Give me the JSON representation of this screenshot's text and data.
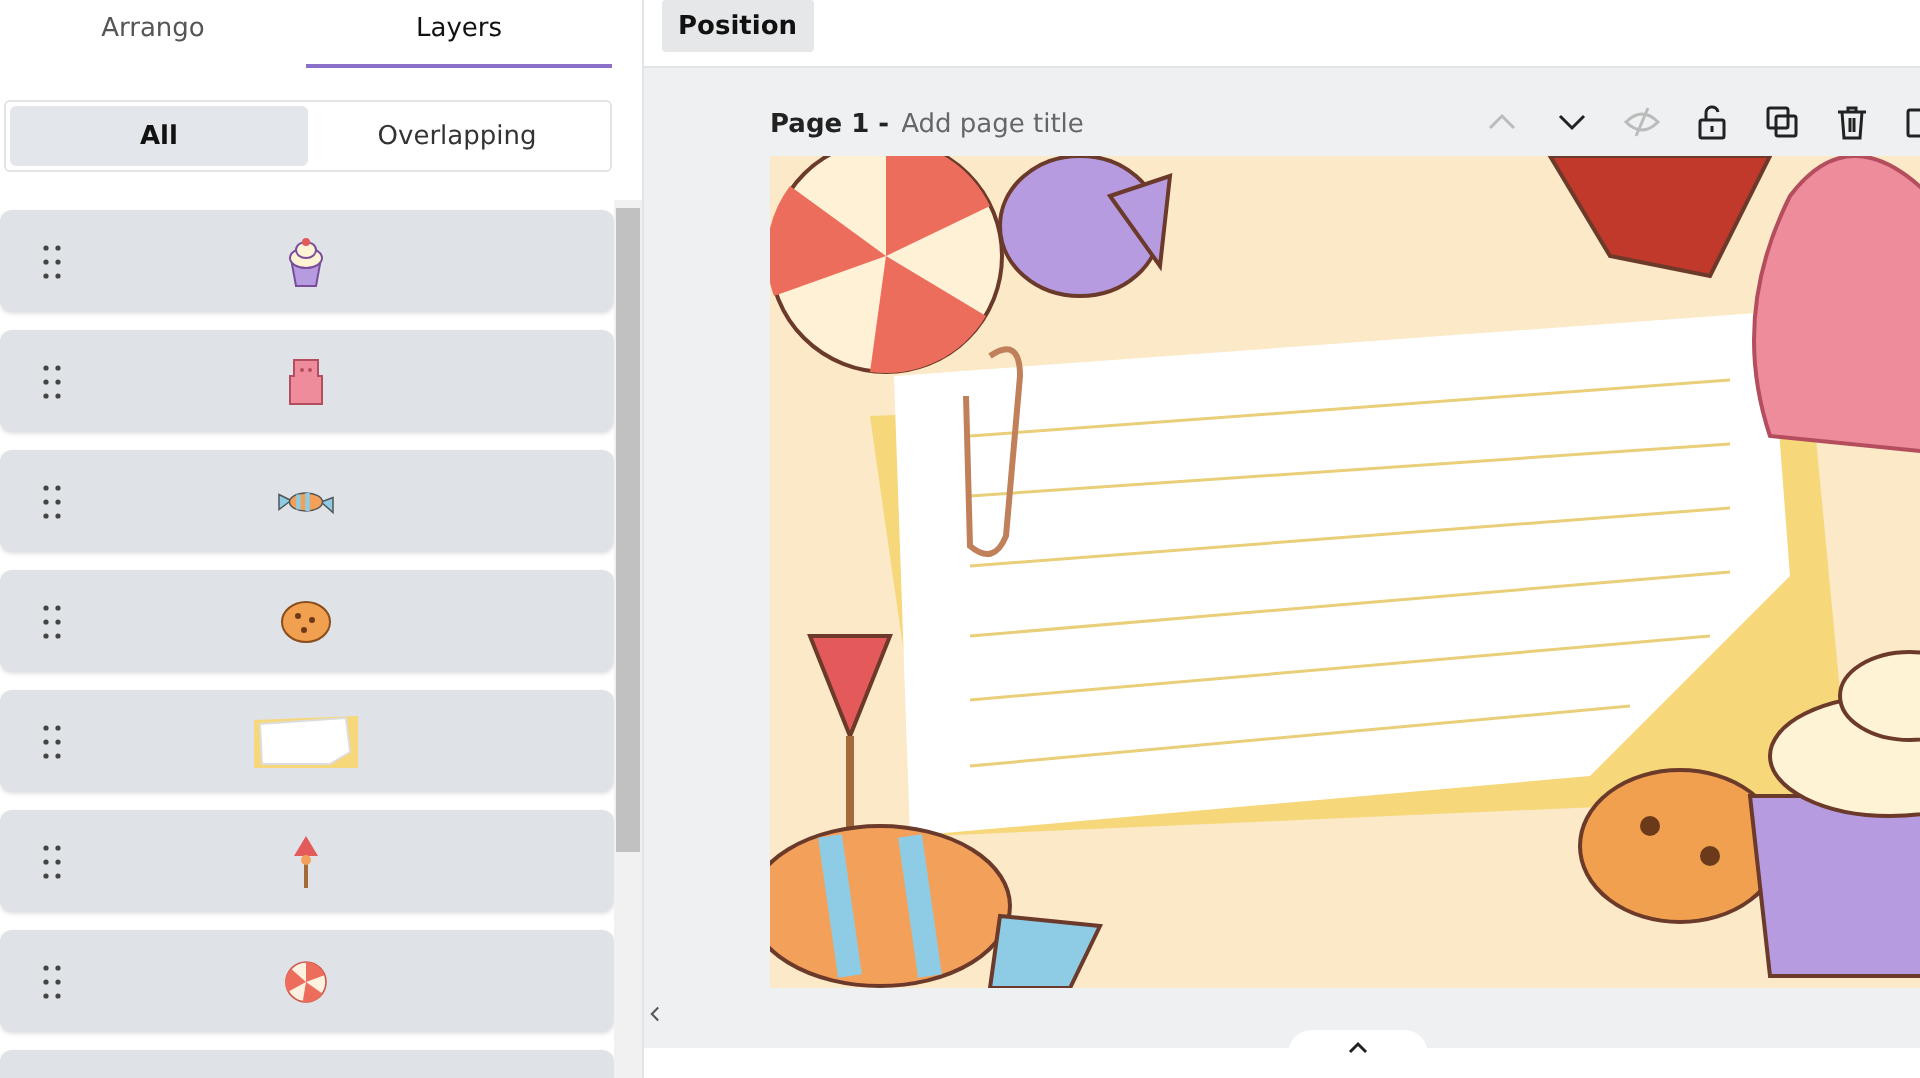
{
  "panel": {
    "tabs": [
      {
        "label": "Arrango",
        "selected": false
      },
      {
        "label": "Layers",
        "selected": true
      }
    ],
    "filters": [
      {
        "label": "All",
        "selected": true
      },
      {
        "label": "Overlapping",
        "selected": false
      }
    ],
    "layers": [
      {
        "kind": "cupcake"
      },
      {
        "kind": "gummy-bear"
      },
      {
        "kind": "wrapped-candy"
      },
      {
        "kind": "cookie"
      },
      {
        "kind": "note"
      },
      {
        "kind": "lollipop"
      },
      {
        "kind": "peppermint"
      },
      {
        "kind": "blank"
      }
    ]
  },
  "editor": {
    "position_button": "Position",
    "page": {
      "label": "Page 1 -",
      "title_placeholder": "Add page title"
    },
    "page_tools": [
      {
        "kind": "move-up",
        "disabled": true
      },
      {
        "kind": "move-down",
        "disabled": false
      },
      {
        "kind": "hide",
        "disabled": true
      },
      {
        "kind": "lock",
        "disabled": false
      },
      {
        "kind": "duplicate",
        "disabled": false
      },
      {
        "kind": "delete",
        "disabled": false
      },
      {
        "kind": "add-page",
        "disabled": false
      }
    ]
  }
}
